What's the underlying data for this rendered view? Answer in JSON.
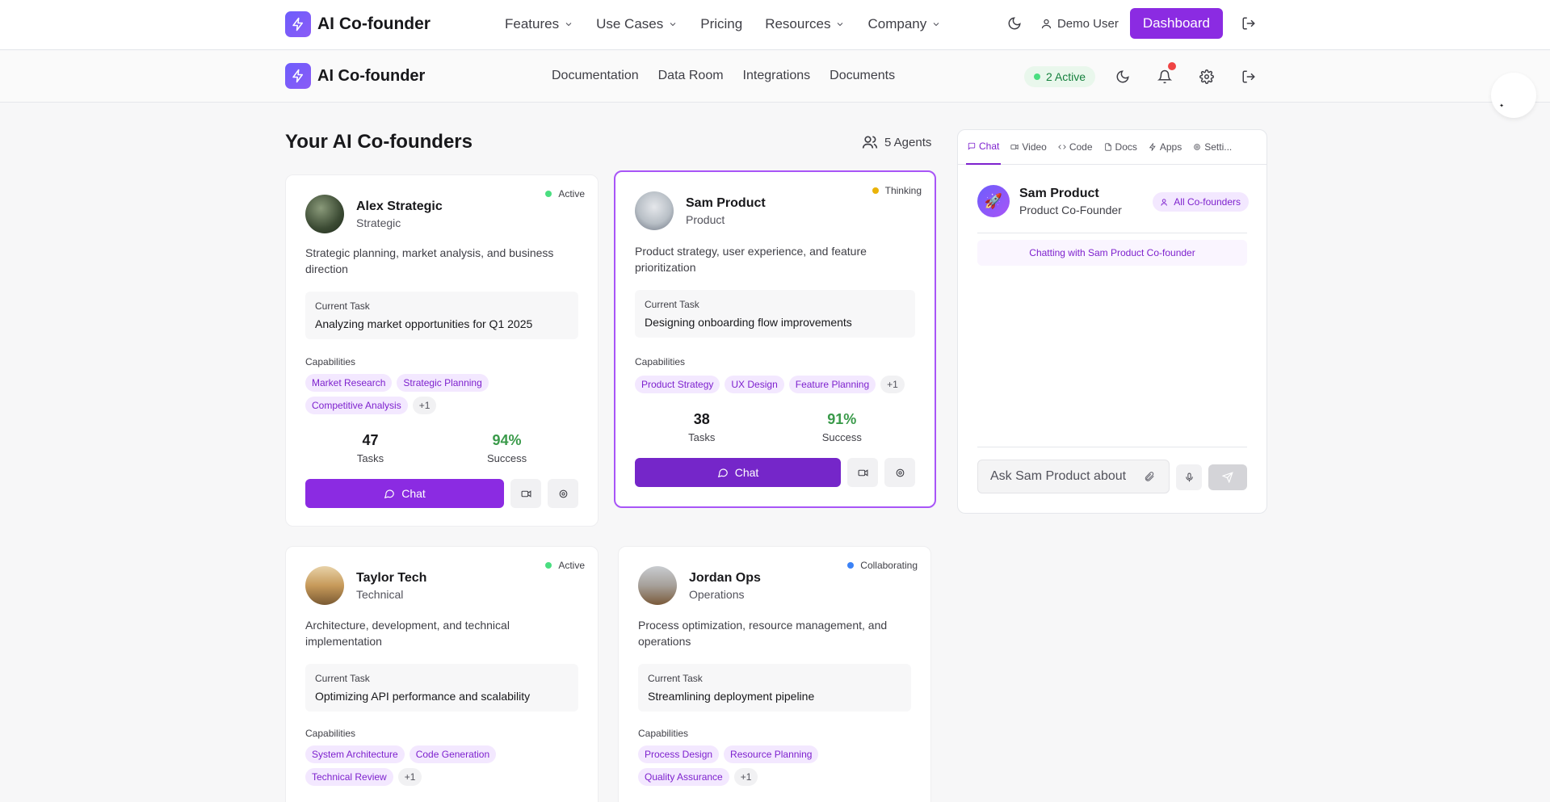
{
  "app": {
    "name": "AI Co-founder"
  },
  "topnav": {
    "links": [
      {
        "label": "Features",
        "dropdown": true
      },
      {
        "label": "Use Cases",
        "dropdown": true
      },
      {
        "label": "Pricing",
        "dropdown": false
      },
      {
        "label": "Resources",
        "dropdown": true
      },
      {
        "label": "Company",
        "dropdown": true
      }
    ],
    "user_label": "Demo User",
    "dashboard_label": "Dashboard"
  },
  "subnav": {
    "links": [
      "Documentation",
      "Data Room",
      "Integrations",
      "Documents"
    ],
    "active_pill": "2 Active"
  },
  "main": {
    "title": "Your AI Co-founders",
    "agents_count": "5 Agents"
  },
  "cards": [
    {
      "name": "Alex Strategic",
      "role": "Strategic",
      "status": "Active",
      "status_color": "#4ade80",
      "description": "Strategic planning, market analysis, and business direction",
      "task_label": "Current Task",
      "task": "Analyzing market opportunities for Q1 2025",
      "capabilities_label": "Capabilities",
      "capabilities": [
        "Market Research",
        "Strategic Planning",
        "Competitive Analysis",
        "+1"
      ],
      "tasks": "47",
      "tasks_label": "Tasks",
      "success": "94%",
      "success_label": "Success",
      "chat_label": "Chat"
    },
    {
      "name": "Sam Product",
      "role": "Product",
      "status": "Thinking",
      "status_color": "#eab308",
      "description": "Product strategy, user experience, and feature prioritization",
      "task_label": "Current Task",
      "task": "Designing onboarding flow improvements",
      "capabilities_label": "Capabilities",
      "capabilities": [
        "Product Strategy",
        "UX Design",
        "Feature Planning",
        "+1"
      ],
      "tasks": "38",
      "tasks_label": "Tasks",
      "success": "91%",
      "success_label": "Success",
      "chat_label": "Chat"
    },
    {
      "name": "Taylor Tech",
      "role": "Technical",
      "status": "Active",
      "status_color": "#4ade80",
      "description": "Architecture, development, and technical implementation",
      "task_label": "Current Task",
      "task": "Optimizing API performance and scalability",
      "capabilities_label": "Capabilities",
      "capabilities": [
        "System Architecture",
        "Code Generation",
        "Technical Review",
        "+1"
      ]
    },
    {
      "name": "Jordan Ops",
      "role": "Operations",
      "status": "Collaborating",
      "status_color": "#3b82f6",
      "description": "Process optimization, resource management, and operations",
      "task_label": "Current Task",
      "task": "Streamlining deployment pipeline",
      "capabilities_label": "Capabilities",
      "capabilities": [
        "Process Design",
        "Resource Planning",
        "Quality Assurance",
        "+1"
      ]
    }
  ],
  "panel": {
    "tabs": [
      "Chat",
      "Video",
      "Code",
      "Docs",
      "Apps",
      "Setti..."
    ],
    "active_tab": "Chat",
    "agent_name": "Sam Product",
    "agent_role": "Product Co-Founder",
    "all_cofounders_label": "All Co-founders",
    "chatting_text": "Chatting with Sam Product Co-founder",
    "input_placeholder": "Ask Sam Product about"
  },
  "colors": {
    "accent": "#8b2be2",
    "success": "#3a9a4a",
    "chip_bg": "#f3e8ff",
    "chip_text": "#7e22ce"
  }
}
